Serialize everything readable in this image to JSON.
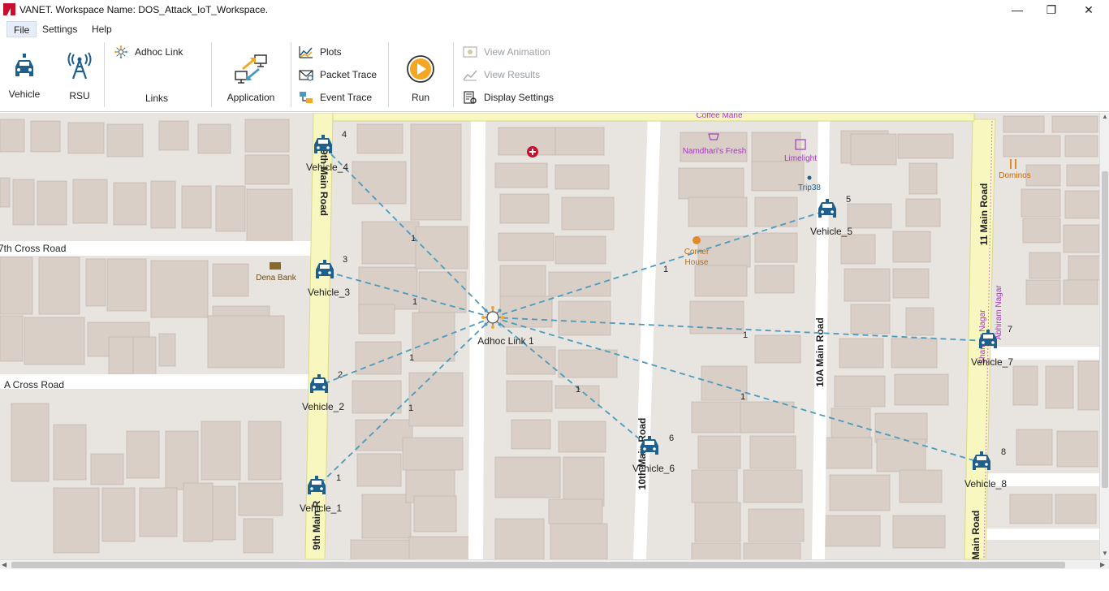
{
  "window": {
    "title": "VANET. Workspace Name: DOS_Attack_IoT_Workspace.",
    "minimize": "—",
    "restore": "❐",
    "close": "✕"
  },
  "menu": [
    "File",
    "Settings",
    "Help"
  ],
  "ribbon": {
    "vehicle": "Vehicle",
    "rsu": "RSU",
    "adhoc_link": "Adhoc Link",
    "links_group": "Links",
    "application": "Application",
    "plots": "Plots",
    "packet_trace": "Packet Trace",
    "event_trace": "Event Trace",
    "run": "Run",
    "view_animation": "View Animation",
    "view_results": "View Results",
    "display_settings": "Display Settings"
  },
  "colors": {
    "accent_blue": "#1f5f8b",
    "link_dash": "#4a9bbf",
    "main_road": "#f7f7bf",
    "building": "#d9cfc7",
    "ground": "#e8e4df",
    "poi_purple": "#a23cb8",
    "run_orange": "#f5a623"
  },
  "map": {
    "streets": [
      "9th Main Road",
      "9th Main R",
      "7th Cross Road",
      "A Cross Road",
      "10th Main Road",
      "10A Main Road",
      "11 Main Road",
      "Main Road",
      "Shankar Nagar",
      "Abhiram Nagar"
    ],
    "pois": [
      "Coffee Mane",
      "Namdhari's Fresh",
      "Limelight",
      "Trip38",
      "Dominos",
      "Dena Bank",
      "Corner House"
    ],
    "adhoc_link": "Adhoc Link 1",
    "vehicles": [
      {
        "name": "Vehicle_1",
        "id": "1"
      },
      {
        "name": "Vehicle_2",
        "id": "2"
      },
      {
        "name": "Vehicle_3",
        "id": "3"
      },
      {
        "name": "Vehicle_4",
        "id": "4"
      },
      {
        "name": "Vehicle_5",
        "id": "5"
      },
      {
        "name": "Vehicle_6",
        "id": "6"
      },
      {
        "name": "Vehicle_7",
        "id": "7"
      },
      {
        "name": "Vehicle_8",
        "id": "8"
      }
    ],
    "link_labels": [
      "1",
      "1",
      "1",
      "1",
      "1",
      "1",
      "1",
      "1"
    ]
  }
}
